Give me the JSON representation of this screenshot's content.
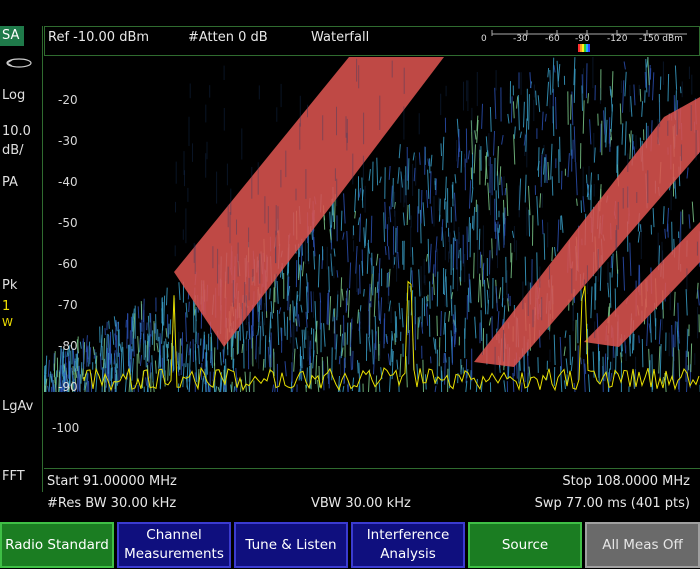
{
  "mode_badge": "SA",
  "left_panel": {
    "scale_type": "Log",
    "scale_per_div_value": "10.0",
    "scale_per_div_unit": "dB/",
    "preamp": "PA",
    "detector": "Pk",
    "trace_number": "1",
    "trace_mode": "W",
    "avg_type": "LgAv",
    "sweep_type": "FFT"
  },
  "header": {
    "ref_level": "Ref -10.00 dBm",
    "attenuation": "#Atten 0 dB",
    "view": "Waterfall",
    "waterfall_scale": [
      "0",
      "-30",
      "-60",
      "-90",
      "-120",
      "-150 dBm"
    ]
  },
  "plot": {
    "y_tick_labels": [
      "-20",
      "-30",
      "-40",
      "-50",
      "-60",
      "-70",
      "-80",
      "-90",
      "-100"
    ],
    "colors": {
      "trace": "#e8e000",
      "waterfall_high": "#d9534f",
      "waterfall_mid": "#3aa0c8",
      "waterfall_low": "#2b4fb0"
    }
  },
  "footer": {
    "start_freq": "Start 91.00000 MHz",
    "stop_freq": "Stop 108.0000 MHz",
    "res_bw": "#Res BW 30.00 kHz",
    "vbw": "VBW 30.00 kHz",
    "sweep": "Swp 77.00 ms (401 pts)"
  },
  "softkeys": [
    {
      "line1": "Radio Standard",
      "line2": ""
    },
    {
      "line1": "Channel",
      "line2": "Measurements"
    },
    {
      "line1": "Tune & Listen",
      "line2": ""
    },
    {
      "line1": "Interference",
      "line2": "Analysis"
    },
    {
      "line1": "Source",
      "line2": ""
    },
    {
      "line1": "All Meas Off",
      "line2": ""
    }
  ]
}
